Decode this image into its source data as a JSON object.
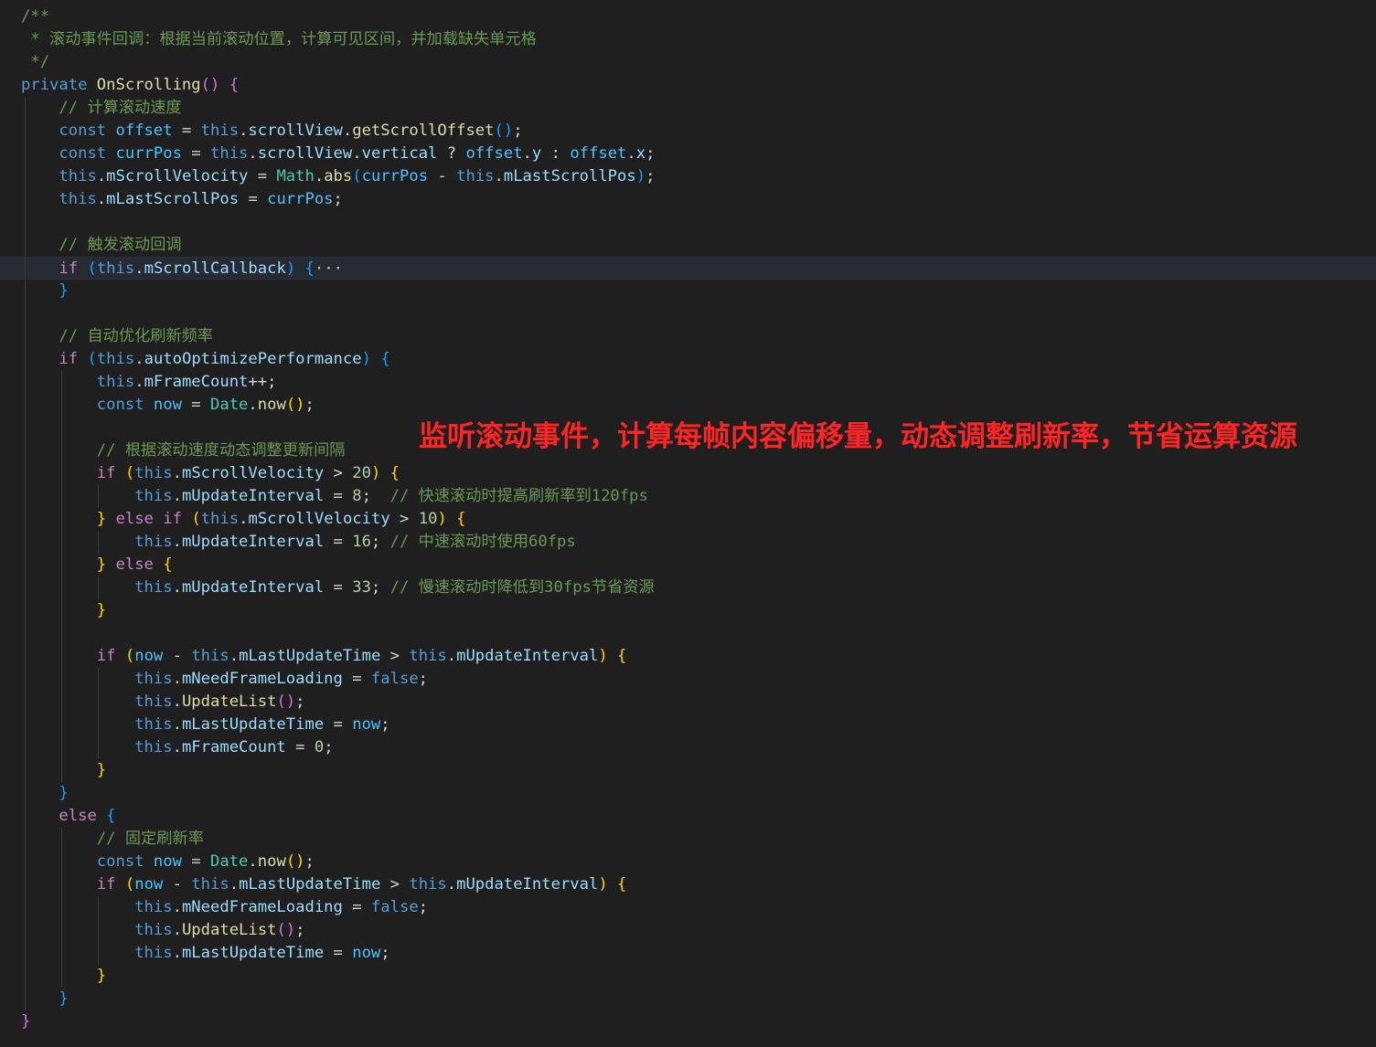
{
  "editor": {
    "lines": [
      [
        [
          "cm",
          "/**"
        ]
      ],
      [
        [
          "cm",
          " * 滚动事件回调：根据当前滚动位置，计算可见区间，并加载缺失单元格"
        ]
      ],
      [
        [
          "cm",
          " */"
        ]
      ],
      [
        [
          "kw",
          "private"
        ],
        [
          "op",
          " "
        ],
        [
          "fn",
          "OnScrolling"
        ],
        [
          "p2",
          "()"
        ],
        [
          "op",
          " "
        ],
        [
          "p2",
          "{"
        ]
      ],
      [
        [
          "op",
          "    "
        ],
        [
          "cm",
          "// 计算滚动速度"
        ]
      ],
      [
        [
          "op",
          "    "
        ],
        [
          "kw",
          "const"
        ],
        [
          "op",
          " "
        ],
        [
          "cv",
          "offset"
        ],
        [
          "op",
          " = "
        ],
        [
          "kw",
          "this"
        ],
        [
          "op",
          "."
        ],
        [
          "vr",
          "scrollView"
        ],
        [
          "op",
          "."
        ],
        [
          "fn",
          "getScrollOffset"
        ],
        [
          "p3",
          "()"
        ],
        [
          "op",
          ";"
        ]
      ],
      [
        [
          "op",
          "    "
        ],
        [
          "kw",
          "const"
        ],
        [
          "op",
          " "
        ],
        [
          "cv",
          "currPos"
        ],
        [
          "op",
          " = "
        ],
        [
          "kw",
          "this"
        ],
        [
          "op",
          "."
        ],
        [
          "vr",
          "scrollView"
        ],
        [
          "op",
          "."
        ],
        [
          "vr",
          "vertical"
        ],
        [
          "op",
          " ? "
        ],
        [
          "cv",
          "offset"
        ],
        [
          "op",
          "."
        ],
        [
          "vr",
          "y"
        ],
        [
          "op",
          " : "
        ],
        [
          "cv",
          "offset"
        ],
        [
          "op",
          "."
        ],
        [
          "vr",
          "x"
        ],
        [
          "op",
          ";"
        ]
      ],
      [
        [
          "op",
          "    "
        ],
        [
          "kw",
          "this"
        ],
        [
          "op",
          "."
        ],
        [
          "vr",
          "mScrollVelocity"
        ],
        [
          "op",
          " = "
        ],
        [
          "ty",
          "Math"
        ],
        [
          "op",
          "."
        ],
        [
          "fn",
          "abs"
        ],
        [
          "p3",
          "("
        ],
        [
          "cv",
          "currPos"
        ],
        [
          "op",
          " - "
        ],
        [
          "kw",
          "this"
        ],
        [
          "op",
          "."
        ],
        [
          "vr",
          "mLastScrollPos"
        ],
        [
          "p3",
          ")"
        ],
        [
          "op",
          ";"
        ]
      ],
      [
        [
          "op",
          "    "
        ],
        [
          "kw",
          "this"
        ],
        [
          "op",
          "."
        ],
        [
          "vr",
          "mLastScrollPos"
        ],
        [
          "op",
          " = "
        ],
        [
          "cv",
          "currPos"
        ],
        [
          "op",
          ";"
        ]
      ],
      [],
      [
        [
          "op",
          "    "
        ],
        [
          "cm",
          "// 触发滚动回调"
        ]
      ],
      [
        [
          "op",
          "    "
        ],
        [
          "ctl",
          "if"
        ],
        [
          "op",
          " "
        ],
        [
          "p3",
          "("
        ],
        [
          "kw",
          "this"
        ],
        [
          "op",
          "."
        ],
        [
          "vr",
          "mScrollCallback"
        ],
        [
          "p3",
          ")"
        ],
        [
          "op",
          " "
        ],
        [
          "p3",
          "{"
        ],
        [
          "fold",
          "···"
        ]
      ],
      [
        [
          "op",
          "    "
        ],
        [
          "p3",
          "}"
        ]
      ],
      [],
      [
        [
          "op",
          "    "
        ],
        [
          "cm",
          "// 自动优化刷新频率"
        ]
      ],
      [
        [
          "op",
          "    "
        ],
        [
          "ctl",
          "if"
        ],
        [
          "op",
          " "
        ],
        [
          "p3",
          "("
        ],
        [
          "kw",
          "this"
        ],
        [
          "op",
          "."
        ],
        [
          "vr",
          "autoOptimizePerformance"
        ],
        [
          "p3",
          ")"
        ],
        [
          "op",
          " "
        ],
        [
          "p3",
          "{"
        ]
      ],
      [
        [
          "op",
          "        "
        ],
        [
          "kw",
          "this"
        ],
        [
          "op",
          "."
        ],
        [
          "vr",
          "mFrameCount"
        ],
        [
          "op",
          "++;"
        ]
      ],
      [
        [
          "op",
          "        "
        ],
        [
          "kw",
          "const"
        ],
        [
          "op",
          " "
        ],
        [
          "cv",
          "now"
        ],
        [
          "op",
          " = "
        ],
        [
          "ty",
          "Date"
        ],
        [
          "op",
          "."
        ],
        [
          "fn",
          "now"
        ],
        [
          "p1",
          "()"
        ],
        [
          "op",
          ";"
        ]
      ],
      [],
      [
        [
          "op",
          "        "
        ],
        [
          "cm",
          "// 根据滚动速度动态调整更新间隔"
        ]
      ],
      [
        [
          "op",
          "        "
        ],
        [
          "ctl",
          "if"
        ],
        [
          "op",
          " "
        ],
        [
          "p1",
          "("
        ],
        [
          "kw",
          "this"
        ],
        [
          "op",
          "."
        ],
        [
          "vr",
          "mScrollVelocity"
        ],
        [
          "op",
          " > "
        ],
        [
          "nm",
          "20"
        ],
        [
          "p1",
          ")"
        ],
        [
          "op",
          " "
        ],
        [
          "p1",
          "{"
        ]
      ],
      [
        [
          "op",
          "            "
        ],
        [
          "kw",
          "this"
        ],
        [
          "op",
          "."
        ],
        [
          "vr",
          "mUpdateInterval"
        ],
        [
          "op",
          " = "
        ],
        [
          "nm",
          "8"
        ],
        [
          "op",
          ";  "
        ],
        [
          "cm",
          "// 快速滚动时提高刷新率到120fps"
        ]
      ],
      [
        [
          "op",
          "        "
        ],
        [
          "p1",
          "}"
        ],
        [
          "op",
          " "
        ],
        [
          "ctl",
          "else"
        ],
        [
          "op",
          " "
        ],
        [
          "ctl",
          "if"
        ],
        [
          "op",
          " "
        ],
        [
          "p1",
          "("
        ],
        [
          "kw",
          "this"
        ],
        [
          "op",
          "."
        ],
        [
          "vr",
          "mScrollVelocity"
        ],
        [
          "op",
          " > "
        ],
        [
          "nm",
          "10"
        ],
        [
          "p1",
          ")"
        ],
        [
          "op",
          " "
        ],
        [
          "p1",
          "{"
        ]
      ],
      [
        [
          "op",
          "            "
        ],
        [
          "kw",
          "this"
        ],
        [
          "op",
          "."
        ],
        [
          "vr",
          "mUpdateInterval"
        ],
        [
          "op",
          " = "
        ],
        [
          "nm",
          "16"
        ],
        [
          "op",
          "; "
        ],
        [
          "cm",
          "// 中速滚动时使用60fps"
        ]
      ],
      [
        [
          "op",
          "        "
        ],
        [
          "p1",
          "}"
        ],
        [
          "op",
          " "
        ],
        [
          "ctl",
          "else"
        ],
        [
          "op",
          " "
        ],
        [
          "p1",
          "{"
        ]
      ],
      [
        [
          "op",
          "            "
        ],
        [
          "kw",
          "this"
        ],
        [
          "op",
          "."
        ],
        [
          "vr",
          "mUpdateInterval"
        ],
        [
          "op",
          " = "
        ],
        [
          "nm",
          "33"
        ],
        [
          "op",
          "; "
        ],
        [
          "cm",
          "// 慢速滚动时降低到30fps节省资源"
        ]
      ],
      [
        [
          "op",
          "        "
        ],
        [
          "p1",
          "}"
        ]
      ],
      [],
      [
        [
          "op",
          "        "
        ],
        [
          "ctl",
          "if"
        ],
        [
          "op",
          " "
        ],
        [
          "p1",
          "("
        ],
        [
          "cv",
          "now"
        ],
        [
          "op",
          " - "
        ],
        [
          "kw",
          "this"
        ],
        [
          "op",
          "."
        ],
        [
          "vr",
          "mLastUpdateTime"
        ],
        [
          "op",
          " > "
        ],
        [
          "kw",
          "this"
        ],
        [
          "op",
          "."
        ],
        [
          "vr",
          "mUpdateInterval"
        ],
        [
          "p1",
          ")"
        ],
        [
          "op",
          " "
        ],
        [
          "p1",
          "{"
        ]
      ],
      [
        [
          "op",
          "            "
        ],
        [
          "kw",
          "this"
        ],
        [
          "op",
          "."
        ],
        [
          "vr",
          "mNeedFrameLoading"
        ],
        [
          "op",
          " = "
        ],
        [
          "kw",
          "false"
        ],
        [
          "op",
          ";"
        ]
      ],
      [
        [
          "op",
          "            "
        ],
        [
          "kw",
          "this"
        ],
        [
          "op",
          "."
        ],
        [
          "fn",
          "UpdateList"
        ],
        [
          "p2",
          "()"
        ],
        [
          "op",
          ";"
        ]
      ],
      [
        [
          "op",
          "            "
        ],
        [
          "kw",
          "this"
        ],
        [
          "op",
          "."
        ],
        [
          "vr",
          "mLastUpdateTime"
        ],
        [
          "op",
          " = "
        ],
        [
          "cv",
          "now"
        ],
        [
          "op",
          ";"
        ]
      ],
      [
        [
          "op",
          "            "
        ],
        [
          "kw",
          "this"
        ],
        [
          "op",
          "."
        ],
        [
          "vr",
          "mFrameCount"
        ],
        [
          "op",
          " = "
        ],
        [
          "nm",
          "0"
        ],
        [
          "op",
          ";"
        ]
      ],
      [
        [
          "op",
          "        "
        ],
        [
          "p1",
          "}"
        ]
      ],
      [
        [
          "op",
          "    "
        ],
        [
          "p3",
          "}"
        ]
      ],
      [
        [
          "op",
          "    "
        ],
        [
          "ctl",
          "else"
        ],
        [
          "op",
          " "
        ],
        [
          "p3",
          "{"
        ]
      ],
      [
        [
          "op",
          "        "
        ],
        [
          "cm",
          "// 固定刷新率"
        ]
      ],
      [
        [
          "op",
          "        "
        ],
        [
          "kw",
          "const"
        ],
        [
          "op",
          " "
        ],
        [
          "cv",
          "now"
        ],
        [
          "op",
          " = "
        ],
        [
          "ty",
          "Date"
        ],
        [
          "op",
          "."
        ],
        [
          "fn",
          "now"
        ],
        [
          "p1",
          "()"
        ],
        [
          "op",
          ";"
        ]
      ],
      [
        [
          "op",
          "        "
        ],
        [
          "ctl",
          "if"
        ],
        [
          "op",
          " "
        ],
        [
          "p1",
          "("
        ],
        [
          "cv",
          "now"
        ],
        [
          "op",
          " - "
        ],
        [
          "kw",
          "this"
        ],
        [
          "op",
          "."
        ],
        [
          "vr",
          "mLastUpdateTime"
        ],
        [
          "op",
          " > "
        ],
        [
          "kw",
          "this"
        ],
        [
          "op",
          "."
        ],
        [
          "vr",
          "mUpdateInterval"
        ],
        [
          "p1",
          ")"
        ],
        [
          "op",
          " "
        ],
        [
          "p1",
          "{"
        ]
      ],
      [
        [
          "op",
          "            "
        ],
        [
          "kw",
          "this"
        ],
        [
          "op",
          "."
        ],
        [
          "vr",
          "mNeedFrameLoading"
        ],
        [
          "op",
          " = "
        ],
        [
          "kw",
          "false"
        ],
        [
          "op",
          ";"
        ]
      ],
      [
        [
          "op",
          "            "
        ],
        [
          "kw",
          "this"
        ],
        [
          "op",
          "."
        ],
        [
          "fn",
          "UpdateList"
        ],
        [
          "p2",
          "()"
        ],
        [
          "op",
          ";"
        ]
      ],
      [
        [
          "op",
          "            "
        ],
        [
          "kw",
          "this"
        ],
        [
          "op",
          "."
        ],
        [
          "vr",
          "mLastUpdateTime"
        ],
        [
          "op",
          " = "
        ],
        [
          "cv",
          "now"
        ],
        [
          "op",
          ";"
        ]
      ],
      [
        [
          "op",
          "        "
        ],
        [
          "p1",
          "}"
        ]
      ],
      [
        [
          "op",
          "    "
        ],
        [
          "p3",
          "}"
        ]
      ],
      [
        [
          "p2",
          "}"
        ]
      ]
    ],
    "indent_guides": [
      [],
      [],
      [],
      [],
      [
        1
      ],
      [
        1
      ],
      [
        1
      ],
      [
        1
      ],
      [
        1
      ],
      [
        1
      ],
      [
        1
      ],
      [
        1
      ],
      [
        1
      ],
      [
        1
      ],
      [
        1
      ],
      [
        1
      ],
      [
        1,
        2
      ],
      [
        1,
        2
      ],
      [
        1,
        2
      ],
      [
        1,
        2
      ],
      [
        1,
        2
      ],
      [
        1,
        2,
        3
      ],
      [
        1,
        2
      ],
      [
        1,
        2,
        3
      ],
      [
        1,
        2
      ],
      [
        1,
        2,
        3
      ],
      [
        1,
        2
      ],
      [
        1,
        2
      ],
      [
        1,
        2
      ],
      [
        1,
        2,
        3
      ],
      [
        1,
        2,
        3
      ],
      [
        1,
        2,
        3
      ],
      [
        1,
        2,
        3
      ],
      [
        1,
        2
      ],
      [
        1
      ],
      [
        1
      ],
      [
        1,
        2
      ],
      [
        1,
        2
      ],
      [
        1,
        2
      ],
      [
        1,
        2,
        3
      ],
      [
        1,
        2,
        3
      ],
      [
        1,
        2,
        3
      ],
      [
        1,
        2
      ],
      [
        1
      ],
      []
    ],
    "current_line": 11
  },
  "annotation": {
    "text": "监听滚动事件，计算每帧内容偏移量，动态调整刷新率，节省运算资源",
    "color": "#ff2424"
  },
  "theme": {
    "background": "#1f1f1f",
    "comment": "#6a9955",
    "keyword": "#569cd6",
    "control": "#c586c0",
    "function": "#dcdcaa",
    "variable": "#9cdcfe",
    "constant": "#4fc1ff",
    "type": "#4ec9b0",
    "number": "#b5cea8"
  }
}
